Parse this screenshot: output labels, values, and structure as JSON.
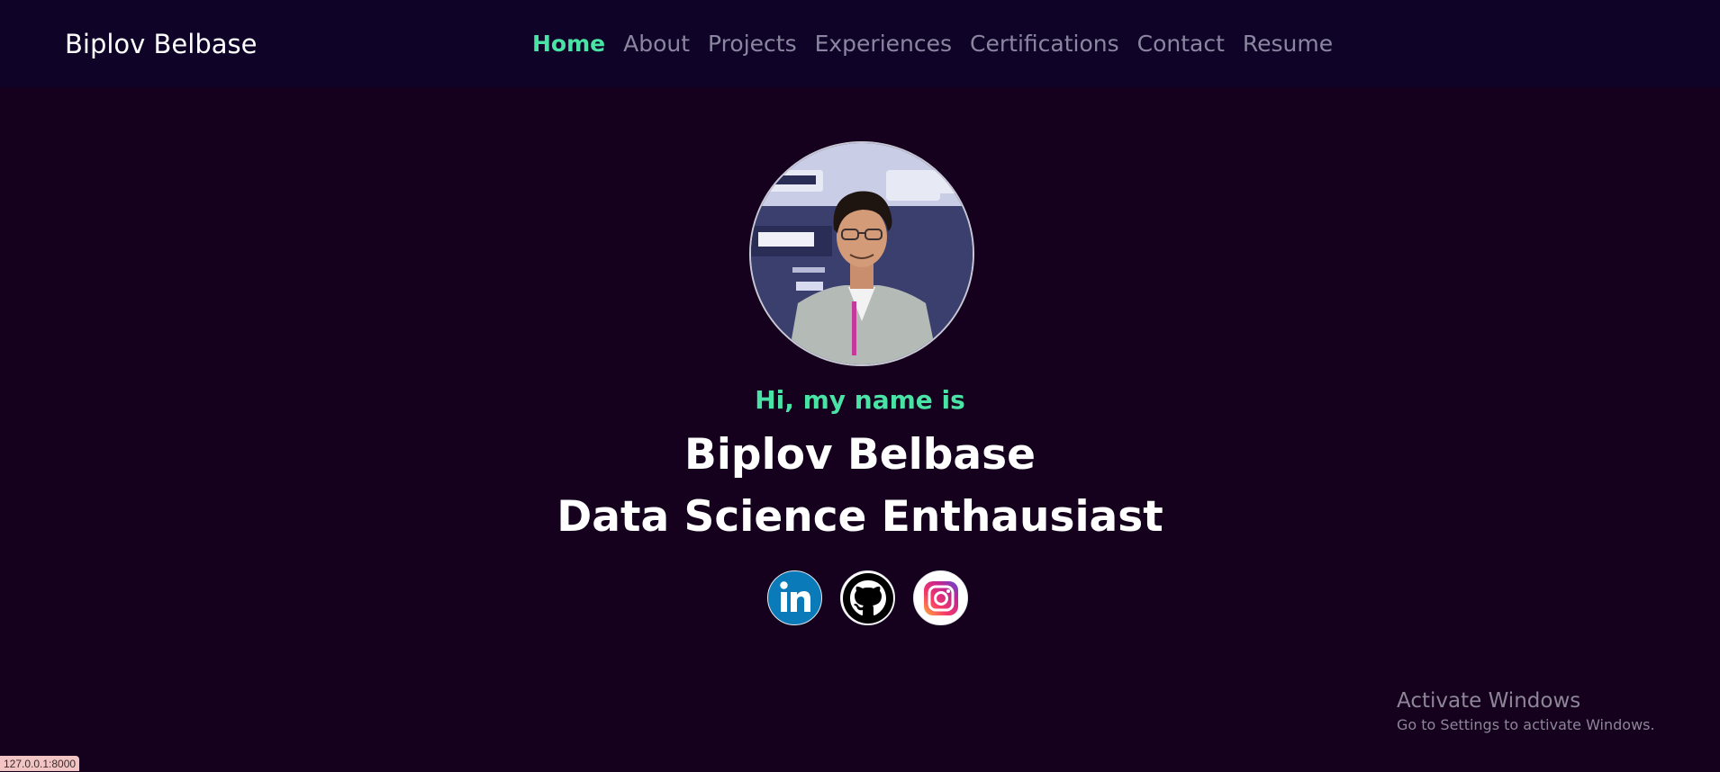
{
  "navbar": {
    "brand": "Biplov Belbase",
    "links": [
      {
        "label": "Home",
        "active": true
      },
      {
        "label": "About",
        "active": false
      },
      {
        "label": "Projects",
        "active": false
      },
      {
        "label": "Experiences",
        "active": false
      },
      {
        "label": "Certifications",
        "active": false
      },
      {
        "label": "Contact",
        "active": false
      },
      {
        "label": "Resume",
        "active": false
      }
    ]
  },
  "hero": {
    "greeting": "Hi, my name is",
    "name": "Biplov Belbase",
    "role": "Data Science Enthausiast",
    "avatar_icon": "profile-photo"
  },
  "socials": [
    {
      "name": "linkedin",
      "icon": "linkedin-icon",
      "color": "#0a7ab8"
    },
    {
      "name": "github",
      "icon": "github-icon",
      "color": "#000000"
    },
    {
      "name": "instagram",
      "icon": "instagram-icon",
      "color": "#e1306c"
    }
  ],
  "watermark": {
    "title": "Activate Windows",
    "subtitle": "Go to Settings to activate Windows."
  },
  "status_url": "127.0.0.1:8000",
  "colors": {
    "background": "#15001e",
    "navbar": "#0f0428",
    "accent": "#4ae3a6",
    "nav_inactive": "#8b86a0"
  }
}
